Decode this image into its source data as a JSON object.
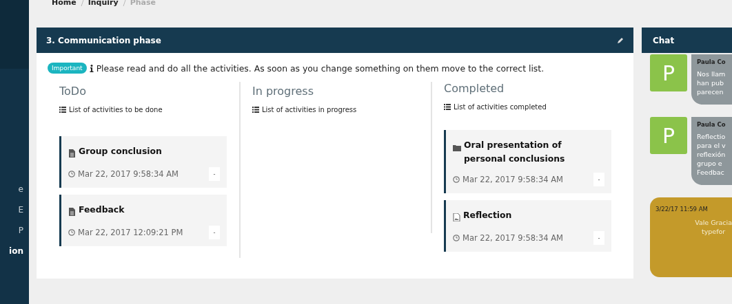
{
  "sidebar": {
    "items": [
      {
        "label": "e",
        "selected": false
      },
      {
        "label": "E",
        "selected": false
      },
      {
        "label": "P",
        "selected": false
      },
      {
        "label": "ion",
        "selected": true
      }
    ]
  },
  "breadcrumb": [
    {
      "label": "Home",
      "selected": false
    },
    {
      "label": "Inquiry",
      "selected": false
    },
    {
      "label": "Phase",
      "selected": true
    }
  ],
  "panel": {
    "title": "3. Communication phase",
    "badge": "Important",
    "notice": "Please read and do all the activities. As soon as you change something on them move to the correct list.",
    "columns": [
      {
        "title": "ToDo",
        "subtitle": "List of activities to be done",
        "cards": [
          {
            "kind": "document",
            "title": "Group conclusion",
            "time": "Mar 22, 2017 9:58:34 AM",
            "button": "-"
          },
          {
            "kind": "document",
            "title": "Feedback",
            "time": "Mar 22, 2017 12:09:21 PM",
            "button": "-"
          }
        ]
      },
      {
        "title": "In progress",
        "subtitle": "List of activities in progress"
      },
      {
        "title": "Completed",
        "subtitle": "List of activities completed",
        "cards": [
          {
            "kind": "folder",
            "title": "Oral presentation of personal conclusions",
            "time": "Mar 22, 2017 9:58:34 AM",
            "button": "-"
          },
          {
            "kind": "image",
            "title": "Reflection",
            "time": "Mar 22, 2017 9:58:34 AM",
            "button": "-"
          }
        ]
      }
    ]
  },
  "chat": {
    "title": "Chat",
    "messages": [
      {
        "kind": "received",
        "avatar": "P",
        "name": "Paula Co",
        "lines": [
          "Nos llam",
          "han pub",
          "parecen"
        ]
      },
      {
        "kind": "received",
        "avatar": "P",
        "name": "Paula Co",
        "lines": [
          "Reflectio",
          "para el v",
          "reflexión",
          "grupo e",
          "Feedbac"
        ]
      },
      {
        "kind": "sent",
        "time": "3/22/17 11:59 AM",
        "lines": [
          "Vale Gracia",
          "typefor"
        ]
      }
    ]
  }
}
